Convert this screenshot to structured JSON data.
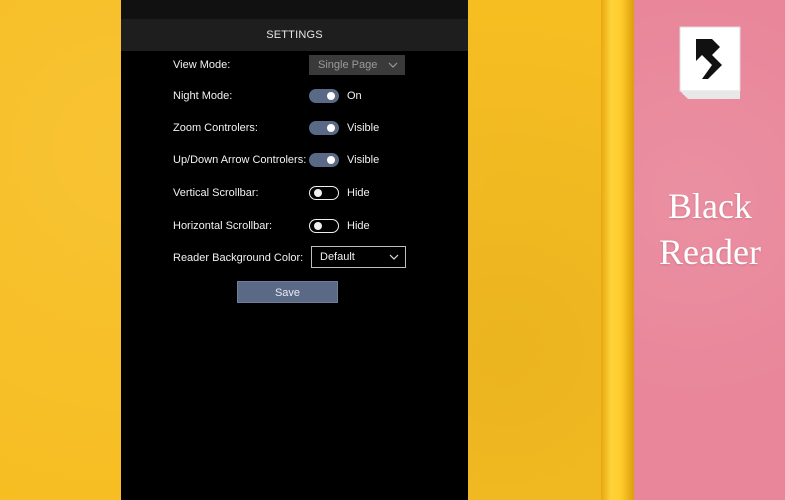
{
  "brand": {
    "name_line1": "Black",
    "name_line2": "Reader",
    "logo_icon": "black-reader-logo-icon"
  },
  "settings": {
    "header": "SETTINGS",
    "view_mode": {
      "label": "View Mode:",
      "value": "Single Page"
    },
    "night_mode": {
      "label": "Night Mode:",
      "state": "On",
      "enabled": true
    },
    "zoom_controls": {
      "label": "Zoom Controlers:",
      "state": "Visible",
      "enabled": true
    },
    "arrow_controls": {
      "label": "Up/Down Arrow Controlers:",
      "state": "Visible",
      "enabled": true
    },
    "vertical_scrollbar": {
      "label": "Vertical Scrollbar:",
      "state": "Hide",
      "enabled": false
    },
    "horizontal_scrollbar": {
      "label": "Horizontal Scrollbar:",
      "state": "Hide",
      "enabled": false
    },
    "background_color": {
      "label": "Reader Background Color:",
      "value": "Default"
    },
    "save_label": "Save"
  },
  "colors": {
    "accent": "#5a6a86",
    "wall_yellow": "#f7be22",
    "wall_pink": "#e9869a",
    "panel": "#000000"
  }
}
